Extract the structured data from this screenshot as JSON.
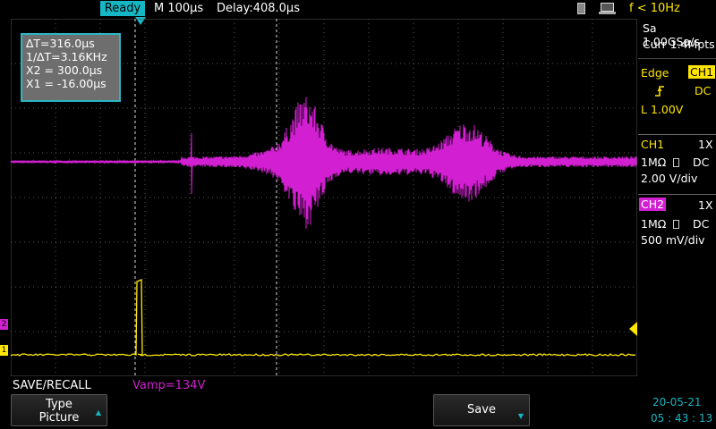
{
  "topbar": {
    "status": "Ready",
    "timebase": "M 100μs",
    "delay": "Delay:408.0μs",
    "freq": "f < 10Hz"
  },
  "cursor_readout": {
    "delta_t": "∆T=316.0μs",
    "inv_delta_t": "1/∆T=3.16KHz",
    "x2": "X2 = 300.0μs",
    "x1": "X1 = -16.00μs"
  },
  "acq": {
    "sample_rate": "Sa 1.00GSa/s",
    "memory": "Curr 1.4Mpts"
  },
  "trigger": {
    "type": "Edge",
    "source": "CH1",
    "slope_icon": "rising-edge-icon",
    "coupling": "DC",
    "level": "L  1.00V"
  },
  "ch1": {
    "name": "CH1",
    "probe": "1X",
    "impedance": "1MΩ",
    "coupling": "DC",
    "scale": "2.00 V/div",
    "color": "#ffe600",
    "marker": "1"
  },
  "ch2": {
    "name": "CH2",
    "probe": "1X",
    "impedance": "1MΩ",
    "coupling": "DC",
    "scale": "500 mV/div",
    "color": "#d11fd1",
    "marker": "2"
  },
  "menu": {
    "title": "SAVE/RECALL",
    "measure": "Vamp=134V",
    "btn1_line1": "Type",
    "btn1_line2": "Picture",
    "btn2": "Save"
  },
  "datetime": {
    "date": "20-05-21",
    "time": "05 : 43 : 13"
  }
}
